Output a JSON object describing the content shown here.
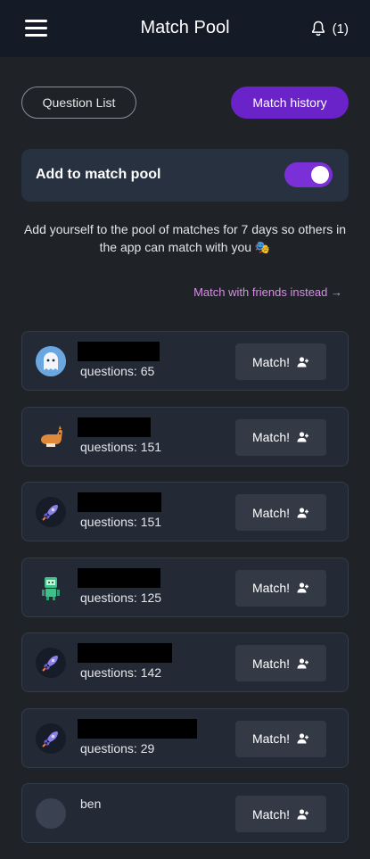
{
  "header": {
    "title": "Match Pool",
    "menu_icon": "hamburger-menu-icon",
    "bell_icon": "bell-icon",
    "notification_count": "(1)"
  },
  "buttons": {
    "question_list": "Question List",
    "match_history": "Match history"
  },
  "pool": {
    "label": "Add to match pool",
    "enabled": true,
    "description": "Add yourself to the pool of matches for 7 days so others in the app can match with you 🎭",
    "friends_link": "Match with friends instead →"
  },
  "colors": {
    "accent": "#6a22c9",
    "toggle": "#7b2fd6",
    "link": "#d98de8",
    "background": "#1f2227"
  },
  "matches": [
    {
      "avatar": "ghost-avatar",
      "questions": "questions: 65",
      "match_label": "Match!"
    },
    {
      "avatar": "corgi-avatar",
      "questions": "questions: 151",
      "match_label": "Match!"
    },
    {
      "avatar": "rocket-avatar",
      "questions": "questions: 151",
      "match_label": "Match!"
    },
    {
      "avatar": "robot-avatar",
      "questions": "questions: 125",
      "match_label": "Match!"
    },
    {
      "avatar": "rocket-avatar",
      "questions": "questions: 142",
      "match_label": "Match!"
    },
    {
      "avatar": "rocket-avatar",
      "questions": "questions: 29",
      "match_label": "Match!"
    },
    {
      "avatar": "ghost-avatar",
      "name": "ben",
      "questions": "",
      "match_label": "Match!"
    }
  ]
}
